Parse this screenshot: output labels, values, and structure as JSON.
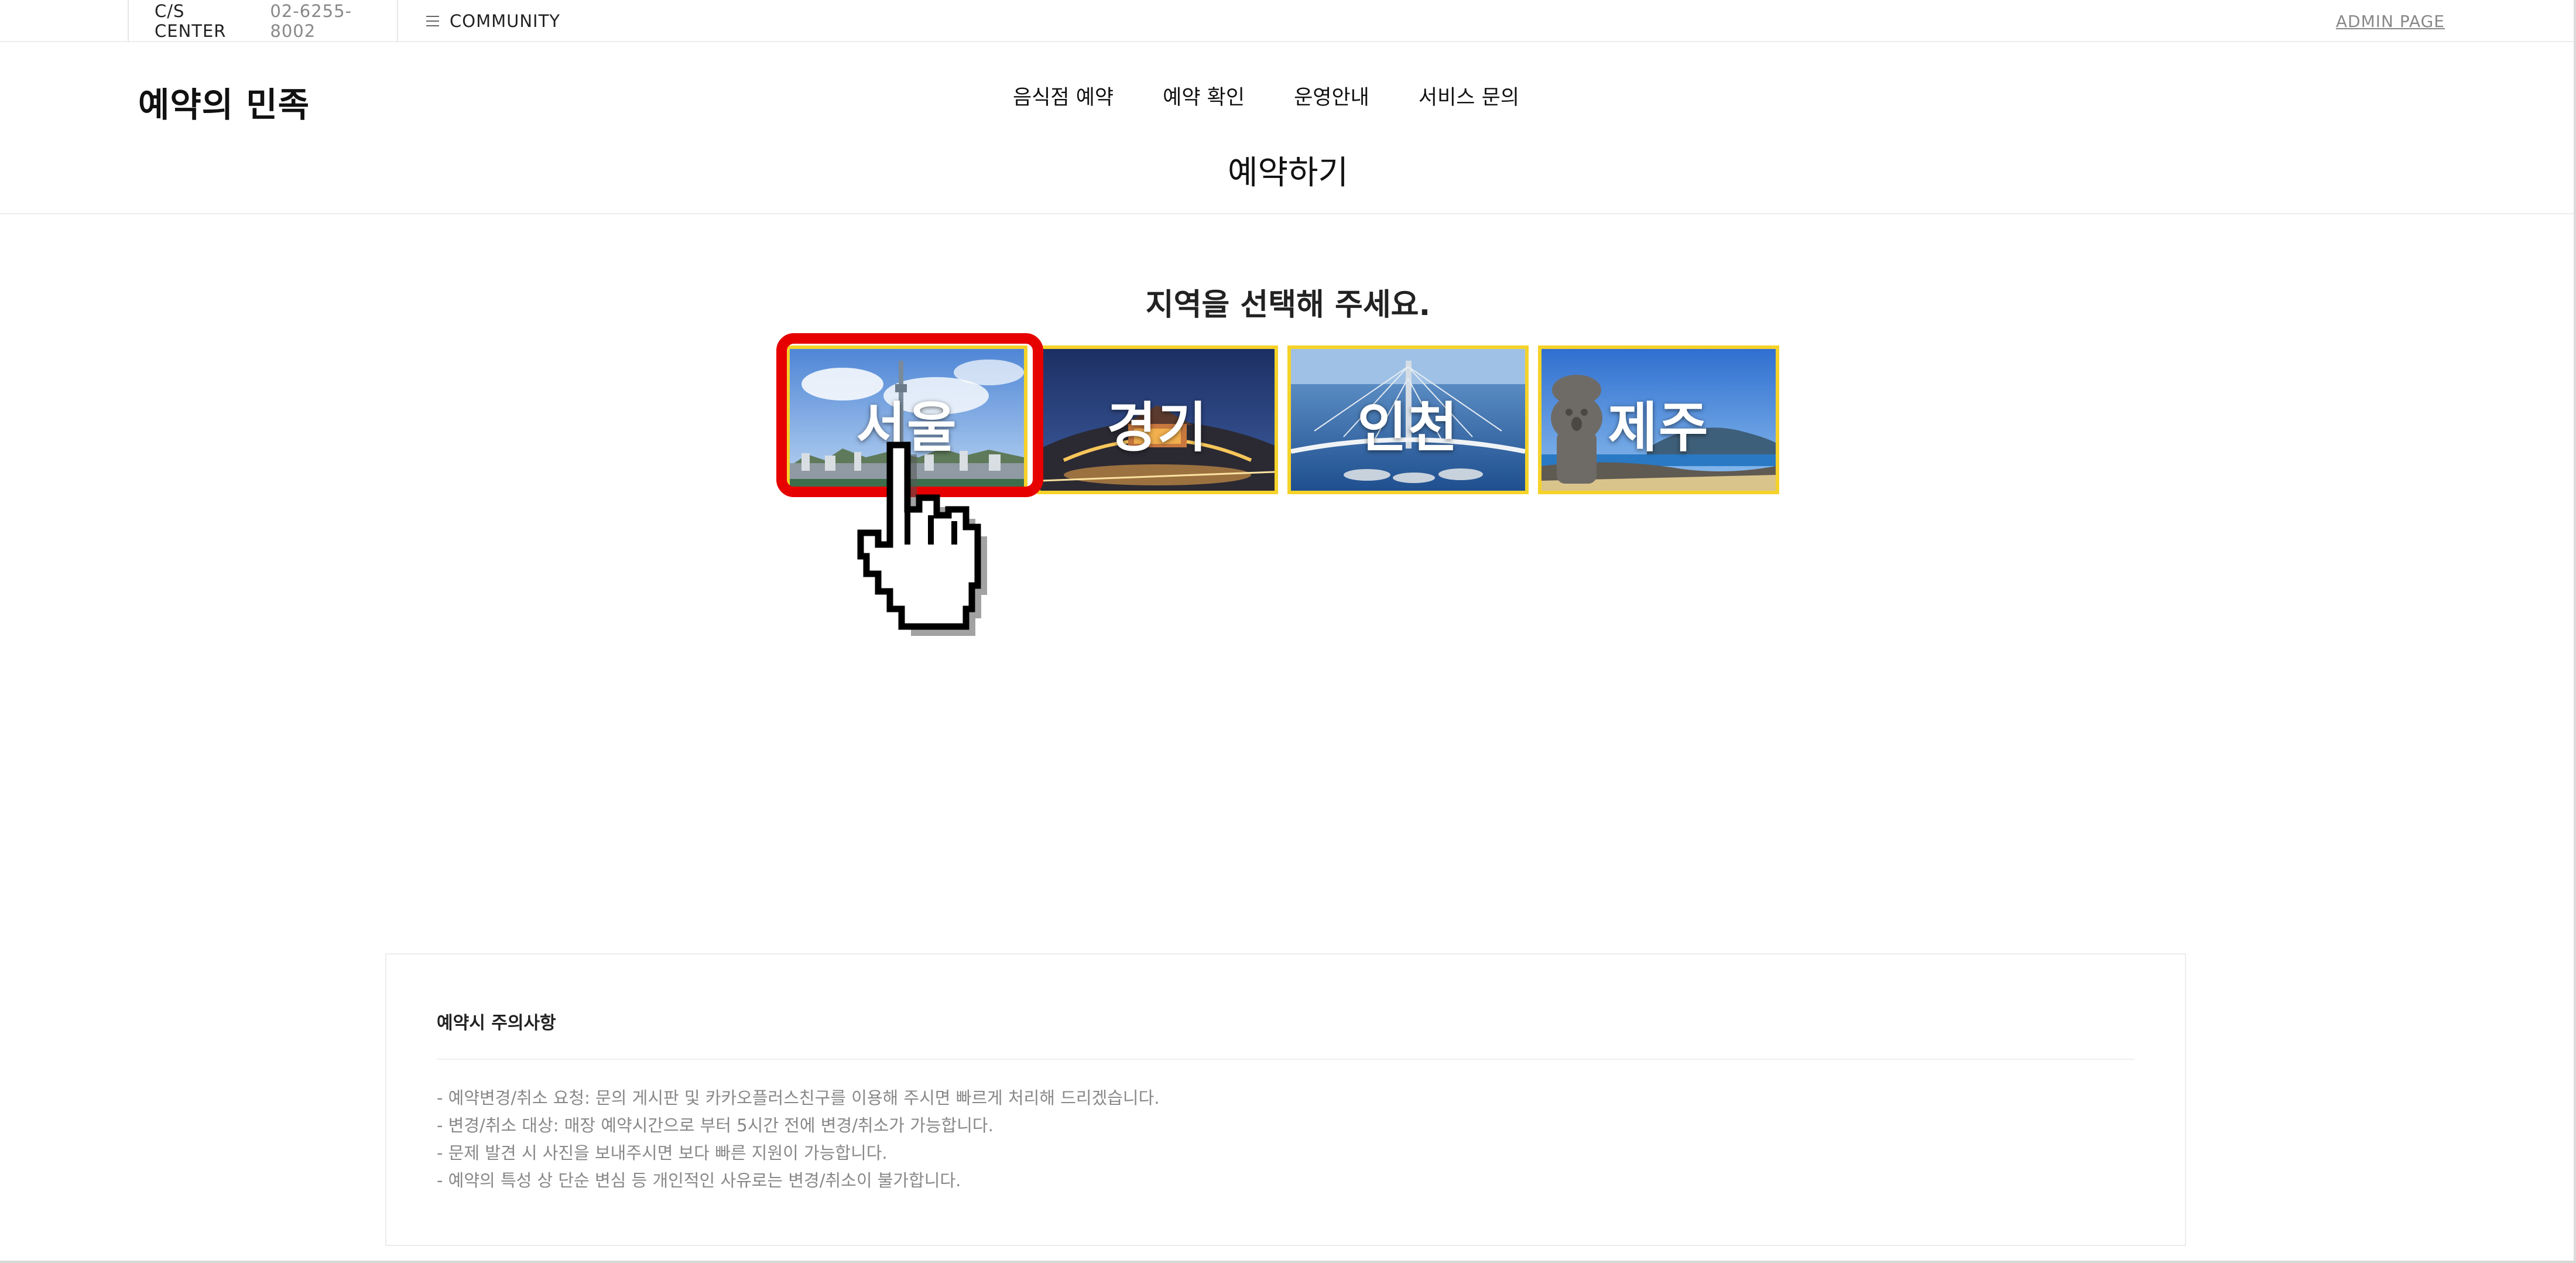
{
  "topbar": {
    "cs_label": "C/S CENTER",
    "cs_phone": "02-6255-8002",
    "community_label": "COMMUNITY",
    "admin_label": "ADMIN PAGE"
  },
  "header": {
    "logo": "예약의 민족",
    "nav": [
      "음식점 예약",
      "예약 확인",
      "운영안내",
      "서비스 문의"
    ],
    "page_title": "예약하기"
  },
  "regions": {
    "heading": "지역을 선택해 주세요.",
    "items": [
      {
        "label": "서울",
        "selected": true
      },
      {
        "label": "경기",
        "selected": false
      },
      {
        "label": "인천",
        "selected": false
      },
      {
        "label": "제주",
        "selected": false
      }
    ]
  },
  "notice": {
    "title": "예약시 주의사항",
    "lines": [
      "- 예약변경/취소 요청: 문의 게시판 및 카카오플러스친구를 이용해 주시면 빠르게 처리해 드리겠습니다.",
      "- 변경/취소 대상: 매장 예약시간으로 부터 5시간 전에 변경/취소가 가능합니다.",
      "- 문제 발견 시 사진을 보내주시면 보다 빠른 지원이 가능합니다.",
      "- 예약의 특성 상 단순 변심 등 개인적인 사유로는 변경/취소이 불가합니다."
    ]
  },
  "colors": {
    "highlight": "#e60000",
    "tile_border": "#f5d22a",
    "muted_text": "#888888"
  },
  "icons": {
    "menu": "hamburger-menu-icon",
    "cursor": "hand-pointer-icon"
  }
}
